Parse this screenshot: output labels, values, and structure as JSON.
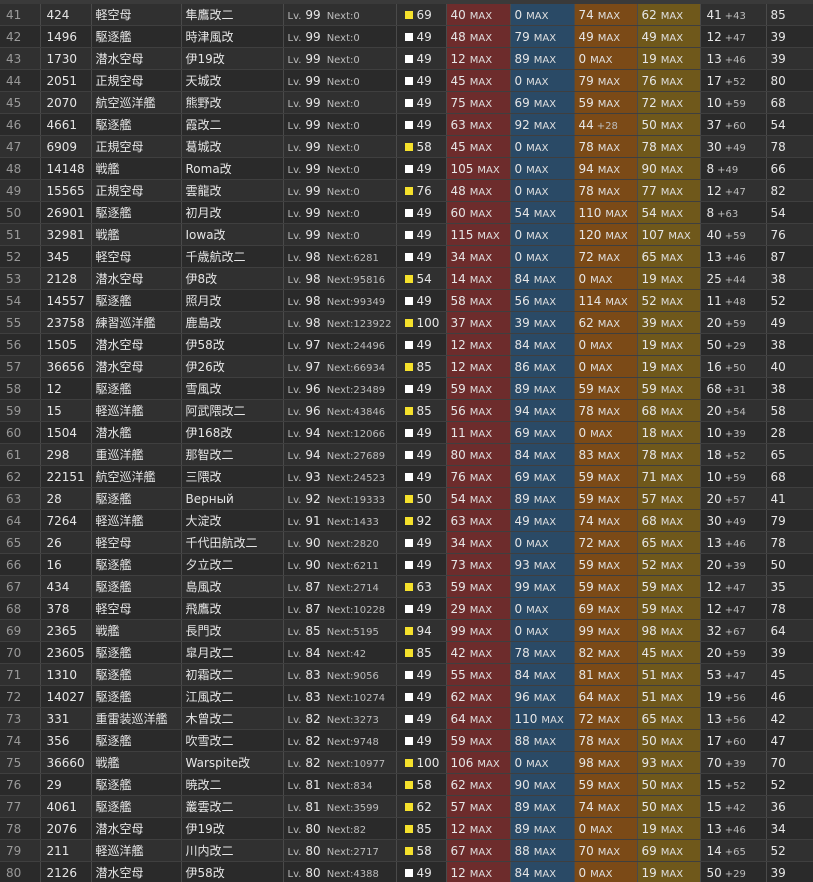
{
  "ship_list": {
    "rows": [
      {
        "idx": "41",
        "id": "424",
        "type": "軽空母",
        "name": "隼鷹改二",
        "lv": "99",
        "next": "Next:0",
        "cond_color": "yellow",
        "cond": "69",
        "fp": "40",
        "fp_max": "MAX",
        "tp": "0",
        "tp_max": "MAX",
        "aa": "74",
        "aa_max": "MAX",
        "ar": "62",
        "ar_max": "MAX",
        "luck": "41",
        "luck_inc": "+43",
        "last": "85"
      },
      {
        "idx": "42",
        "id": "1496",
        "type": "駆逐艦",
        "name": "時津風改",
        "lv": "99",
        "next": "Next:0",
        "cond_color": "white",
        "cond": "49",
        "fp": "48",
        "fp_max": "MAX",
        "tp": "79",
        "tp_max": "MAX",
        "aa": "49",
        "aa_max": "MAX",
        "ar": "49",
        "ar_max": "MAX",
        "luck": "12",
        "luck_inc": "+47",
        "last": "39"
      },
      {
        "idx": "43",
        "id": "1730",
        "type": "潜水空母",
        "name": "伊19改",
        "lv": "99",
        "next": "Next:0",
        "cond_color": "white",
        "cond": "49",
        "fp": "12",
        "fp_max": "MAX",
        "tp": "89",
        "tp_max": "MAX",
        "aa": "0",
        "aa_max": "MAX",
        "ar": "19",
        "ar_max": "MAX",
        "luck": "13",
        "luck_inc": "+46",
        "last": "39"
      },
      {
        "idx": "44",
        "id": "2051",
        "type": "正規空母",
        "name": "天城改",
        "lv": "99",
        "next": "Next:0",
        "cond_color": "white",
        "cond": "49",
        "fp": "45",
        "fp_max": "MAX",
        "tp": "0",
        "tp_max": "MAX",
        "aa": "79",
        "aa_max": "MAX",
        "ar": "76",
        "ar_max": "MAX",
        "luck": "17",
        "luck_inc": "+52",
        "last": "80"
      },
      {
        "idx": "45",
        "id": "2070",
        "type": "航空巡洋艦",
        "name": "熊野改",
        "lv": "99",
        "next": "Next:0",
        "cond_color": "white",
        "cond": "49",
        "fp": "75",
        "fp_max": "MAX",
        "tp": "69",
        "tp_max": "MAX",
        "aa": "59",
        "aa_max": "MAX",
        "ar": "72",
        "ar_max": "MAX",
        "luck": "10",
        "luck_inc": "+59",
        "last": "68"
      },
      {
        "idx": "46",
        "id": "4661",
        "type": "駆逐艦",
        "name": "霞改二",
        "lv": "99",
        "next": "Next:0",
        "cond_color": "white",
        "cond": "49",
        "fp": "63",
        "fp_max": "MAX",
        "tp": "92",
        "tp_max": "MAX",
        "aa": "44",
        "aa_max": "+28",
        "ar": "50",
        "ar_max": "MAX",
        "luck": "37",
        "luck_inc": "+60",
        "last": "54"
      },
      {
        "idx": "47",
        "id": "6909",
        "type": "正規空母",
        "name": "葛城改",
        "lv": "99",
        "next": "Next:0",
        "cond_color": "yellow",
        "cond": "58",
        "fp": "45",
        "fp_max": "MAX",
        "tp": "0",
        "tp_max": "MAX",
        "aa": "78",
        "aa_max": "MAX",
        "ar": "78",
        "ar_max": "MAX",
        "luck": "30",
        "luck_inc": "+49",
        "last": "78"
      },
      {
        "idx": "48",
        "id": "14148",
        "type": "戦艦",
        "name": "Roma改",
        "lv": "99",
        "next": "Next:0",
        "cond_color": "white",
        "cond": "49",
        "fp": "105",
        "fp_max": "MAX",
        "tp": "0",
        "tp_max": "MAX",
        "aa": "94",
        "aa_max": "MAX",
        "ar": "90",
        "ar_max": "MAX",
        "luck": "8",
        "luck_inc": "+49",
        "last": "66"
      },
      {
        "idx": "49",
        "id": "15565",
        "type": "正規空母",
        "name": "雲龍改",
        "lv": "99",
        "next": "Next:0",
        "cond_color": "yellow",
        "cond": "76",
        "fp": "48",
        "fp_max": "MAX",
        "tp": "0",
        "tp_max": "MAX",
        "aa": "78",
        "aa_max": "MAX",
        "ar": "77",
        "ar_max": "MAX",
        "luck": "12",
        "luck_inc": "+47",
        "last": "82"
      },
      {
        "idx": "50",
        "id": "26901",
        "type": "駆逐艦",
        "name": "初月改",
        "lv": "99",
        "next": "Next:0",
        "cond_color": "white",
        "cond": "49",
        "fp": "60",
        "fp_max": "MAX",
        "tp": "54",
        "tp_max": "MAX",
        "aa": "110",
        "aa_max": "MAX",
        "ar": "54",
        "ar_max": "MAX",
        "luck": "8",
        "luck_inc": "+63",
        "last": "54"
      },
      {
        "idx": "51",
        "id": "32981",
        "type": "戦艦",
        "name": "Iowa改",
        "lv": "99",
        "next": "Next:0",
        "cond_color": "white",
        "cond": "49",
        "fp": "115",
        "fp_max": "MAX",
        "tp": "0",
        "tp_max": "MAX",
        "aa": "120",
        "aa_max": "MAX",
        "ar": "107",
        "ar_max": "MAX",
        "luck": "40",
        "luck_inc": "+59",
        "last": "76"
      },
      {
        "idx": "52",
        "id": "345",
        "type": "軽空母",
        "name": "千歳航改二",
        "lv": "98",
        "next": "Next:6281",
        "cond_color": "white",
        "cond": "49",
        "fp": "34",
        "fp_max": "MAX",
        "tp": "0",
        "tp_max": "MAX",
        "aa": "72",
        "aa_max": "MAX",
        "ar": "65",
        "ar_max": "MAX",
        "luck": "13",
        "luck_inc": "+46",
        "last": "87"
      },
      {
        "idx": "53",
        "id": "2128",
        "type": "潜水空母",
        "name": "伊8改",
        "lv": "98",
        "next": "Next:95816",
        "cond_color": "yellow",
        "cond": "54",
        "fp": "14",
        "fp_max": "MAX",
        "tp": "84",
        "tp_max": "MAX",
        "aa": "0",
        "aa_max": "MAX",
        "ar": "19",
        "ar_max": "MAX",
        "luck": "25",
        "luck_inc": "+44",
        "last": "38"
      },
      {
        "idx": "54",
        "id": "14557",
        "type": "駆逐艦",
        "name": "照月改",
        "lv": "98",
        "next": "Next:99349",
        "cond_color": "white",
        "cond": "49",
        "fp": "58",
        "fp_max": "MAX",
        "tp": "56",
        "tp_max": "MAX",
        "aa": "114",
        "aa_max": "MAX",
        "ar": "52",
        "ar_max": "MAX",
        "luck": "11",
        "luck_inc": "+48",
        "last": "52"
      },
      {
        "idx": "55",
        "id": "23758",
        "type": "練習巡洋艦",
        "name": "鹿島改",
        "lv": "98",
        "next": "Next:123922",
        "cond_color": "yellow",
        "cond": "100",
        "fp": "37",
        "fp_max": "MAX",
        "tp": "39",
        "tp_max": "MAX",
        "aa": "62",
        "aa_max": "MAX",
        "ar": "39",
        "ar_max": "MAX",
        "luck": "20",
        "luck_inc": "+59",
        "last": "49"
      },
      {
        "idx": "56",
        "id": "1505",
        "type": "潜水空母",
        "name": "伊58改",
        "lv": "97",
        "next": "Next:24496",
        "cond_color": "white",
        "cond": "49",
        "fp": "12",
        "fp_max": "MAX",
        "tp": "84",
        "tp_max": "MAX",
        "aa": "0",
        "aa_max": "MAX",
        "ar": "19",
        "ar_max": "MAX",
        "luck": "50",
        "luck_inc": "+29",
        "last": "38"
      },
      {
        "idx": "57",
        "id": "36656",
        "type": "潜水空母",
        "name": "伊26改",
        "lv": "97",
        "next": "Next:66934",
        "cond_color": "yellow",
        "cond": "85",
        "fp": "12",
        "fp_max": "MAX",
        "tp": "86",
        "tp_max": "MAX",
        "aa": "0",
        "aa_max": "MAX",
        "ar": "19",
        "ar_max": "MAX",
        "luck": "16",
        "luck_inc": "+50",
        "last": "40"
      },
      {
        "idx": "58",
        "id": "12",
        "type": "駆逐艦",
        "name": "雪風改",
        "lv": "96",
        "next": "Next:23489",
        "cond_color": "white",
        "cond": "49",
        "fp": "59",
        "fp_max": "MAX",
        "tp": "89",
        "tp_max": "MAX",
        "aa": "59",
        "aa_max": "MAX",
        "ar": "59",
        "ar_max": "MAX",
        "luck": "68",
        "luck_inc": "+31",
        "last": "38"
      },
      {
        "idx": "59",
        "id": "15",
        "type": "軽巡洋艦",
        "name": "阿武隈改二",
        "lv": "96",
        "next": "Next:43846",
        "cond_color": "yellow",
        "cond": "85",
        "fp": "56",
        "fp_max": "MAX",
        "tp": "94",
        "tp_max": "MAX",
        "aa": "78",
        "aa_max": "MAX",
        "ar": "68",
        "ar_max": "MAX",
        "luck": "20",
        "luck_inc": "+54",
        "last": "58"
      },
      {
        "idx": "60",
        "id": "1504",
        "type": "潜水艦",
        "name": "伊168改",
        "lv": "94",
        "next": "Next:12066",
        "cond_color": "white",
        "cond": "49",
        "fp": "11",
        "fp_max": "MAX",
        "tp": "69",
        "tp_max": "MAX",
        "aa": "0",
        "aa_max": "MAX",
        "ar": "18",
        "ar_max": "MAX",
        "luck": "10",
        "luck_inc": "+39",
        "last": "28"
      },
      {
        "idx": "61",
        "id": "298",
        "type": "重巡洋艦",
        "name": "那智改二",
        "lv": "94",
        "next": "Next:27689",
        "cond_color": "white",
        "cond": "49",
        "fp": "80",
        "fp_max": "MAX",
        "tp": "84",
        "tp_max": "MAX",
        "aa": "83",
        "aa_max": "MAX",
        "ar": "78",
        "ar_max": "MAX",
        "luck": "18",
        "luck_inc": "+52",
        "last": "65"
      },
      {
        "idx": "62",
        "id": "22151",
        "type": "航空巡洋艦",
        "name": "三隈改",
        "lv": "93",
        "next": "Next:24523",
        "cond_color": "white",
        "cond": "49",
        "fp": "76",
        "fp_max": "MAX",
        "tp": "69",
        "tp_max": "MAX",
        "aa": "59",
        "aa_max": "MAX",
        "ar": "71",
        "ar_max": "MAX",
        "luck": "10",
        "luck_inc": "+59",
        "last": "68"
      },
      {
        "idx": "63",
        "id": "28",
        "type": "駆逐艦",
        "name": "Верный",
        "lv": "92",
        "next": "Next:19333",
        "cond_color": "yellow",
        "cond": "50",
        "fp": "54",
        "fp_max": "MAX",
        "tp": "89",
        "tp_max": "MAX",
        "aa": "59",
        "aa_max": "MAX",
        "ar": "57",
        "ar_max": "MAX",
        "luck": "20",
        "luck_inc": "+57",
        "last": "41"
      },
      {
        "idx": "64",
        "id": "7264",
        "type": "軽巡洋艦",
        "name": "大淀改",
        "lv": "91",
        "next": "Next:1433",
        "cond_color": "yellow",
        "cond": "92",
        "fp": "63",
        "fp_max": "MAX",
        "tp": "49",
        "tp_max": "MAX",
        "aa": "74",
        "aa_max": "MAX",
        "ar": "68",
        "ar_max": "MAX",
        "luck": "30",
        "luck_inc": "+49",
        "last": "79"
      },
      {
        "idx": "65",
        "id": "26",
        "type": "軽空母",
        "name": "千代田航改二",
        "lv": "90",
        "next": "Next:2820",
        "cond_color": "white",
        "cond": "49",
        "fp": "34",
        "fp_max": "MAX",
        "tp": "0",
        "tp_max": "MAX",
        "aa": "72",
        "aa_max": "MAX",
        "ar": "65",
        "ar_max": "MAX",
        "luck": "13",
        "luck_inc": "+46",
        "last": "78"
      },
      {
        "idx": "66",
        "id": "16",
        "type": "駆逐艦",
        "name": "夕立改二",
        "lv": "90",
        "next": "Next:6211",
        "cond_color": "white",
        "cond": "49",
        "fp": "73",
        "fp_max": "MAX",
        "tp": "93",
        "tp_max": "MAX",
        "aa": "59",
        "aa_max": "MAX",
        "ar": "52",
        "ar_max": "MAX",
        "luck": "20",
        "luck_inc": "+39",
        "last": "50"
      },
      {
        "idx": "67",
        "id": "434",
        "type": "駆逐艦",
        "name": "島風改",
        "lv": "87",
        "next": "Next:2714",
        "cond_color": "yellow",
        "cond": "63",
        "fp": "59",
        "fp_max": "MAX",
        "tp": "99",
        "tp_max": "MAX",
        "aa": "59",
        "aa_max": "MAX",
        "ar": "59",
        "ar_max": "MAX",
        "luck": "12",
        "luck_inc": "+47",
        "last": "35"
      },
      {
        "idx": "68",
        "id": "378",
        "type": "軽空母",
        "name": "飛鷹改",
        "lv": "87",
        "next": "Next:10228",
        "cond_color": "white",
        "cond": "49",
        "fp": "29",
        "fp_max": "MAX",
        "tp": "0",
        "tp_max": "MAX",
        "aa": "69",
        "aa_max": "MAX",
        "ar": "59",
        "ar_max": "MAX",
        "luck": "12",
        "luck_inc": "+47",
        "last": "78"
      },
      {
        "idx": "69",
        "id": "2365",
        "type": "戦艦",
        "name": "長門改",
        "lv": "85",
        "next": "Next:5195",
        "cond_color": "yellow",
        "cond": "94",
        "fp": "99",
        "fp_max": "MAX",
        "tp": "0",
        "tp_max": "MAX",
        "aa": "99",
        "aa_max": "MAX",
        "ar": "98",
        "ar_max": "MAX",
        "luck": "32",
        "luck_inc": "+67",
        "last": "64"
      },
      {
        "idx": "70",
        "id": "23605",
        "type": "駆逐艦",
        "name": "皐月改二",
        "lv": "84",
        "next": "Next:42",
        "cond_color": "yellow",
        "cond": "85",
        "fp": "42",
        "fp_max": "MAX",
        "tp": "78",
        "tp_max": "MAX",
        "aa": "82",
        "aa_max": "MAX",
        "ar": "45",
        "ar_max": "MAX",
        "luck": "20",
        "luck_inc": "+59",
        "last": "39"
      },
      {
        "idx": "71",
        "id": "1310",
        "type": "駆逐艦",
        "name": "初霜改二",
        "lv": "83",
        "next": "Next:9056",
        "cond_color": "white",
        "cond": "49",
        "fp": "55",
        "fp_max": "MAX",
        "tp": "84",
        "tp_max": "MAX",
        "aa": "81",
        "aa_max": "MAX",
        "ar": "51",
        "ar_max": "MAX",
        "luck": "53",
        "luck_inc": "+47",
        "last": "45"
      },
      {
        "idx": "72",
        "id": "14027",
        "type": "駆逐艦",
        "name": "江風改二",
        "lv": "83",
        "next": "Next:10274",
        "cond_color": "white",
        "cond": "49",
        "fp": "62",
        "fp_max": "MAX",
        "tp": "96",
        "tp_max": "MAX",
        "aa": "64",
        "aa_max": "MAX",
        "ar": "51",
        "ar_max": "MAX",
        "luck": "19",
        "luck_inc": "+56",
        "last": "46"
      },
      {
        "idx": "73",
        "id": "331",
        "type": "重雷装巡洋艦",
        "name": "木曾改二",
        "lv": "82",
        "next": "Next:3273",
        "cond_color": "white",
        "cond": "49",
        "fp": "64",
        "fp_max": "MAX",
        "tp": "110",
        "tp_max": "MAX",
        "aa": "72",
        "aa_max": "MAX",
        "ar": "65",
        "ar_max": "MAX",
        "luck": "13",
        "luck_inc": "+56",
        "last": "42"
      },
      {
        "idx": "74",
        "id": "356",
        "type": "駆逐艦",
        "name": "吹雪改二",
        "lv": "82",
        "next": "Next:9748",
        "cond_color": "white",
        "cond": "49",
        "fp": "59",
        "fp_max": "MAX",
        "tp": "88",
        "tp_max": "MAX",
        "aa": "78",
        "aa_max": "MAX",
        "ar": "50",
        "ar_max": "MAX",
        "luck": "17",
        "luck_inc": "+60",
        "last": "47"
      },
      {
        "idx": "75",
        "id": "36660",
        "type": "戦艦",
        "name": "Warspite改",
        "lv": "82",
        "next": "Next:10977",
        "cond_color": "yellow",
        "cond": "100",
        "fp": "106",
        "fp_max": "MAX",
        "tp": "0",
        "tp_max": "MAX",
        "aa": "98",
        "aa_max": "MAX",
        "ar": "93",
        "ar_max": "MAX",
        "luck": "70",
        "luck_inc": "+39",
        "last": "70"
      },
      {
        "idx": "76",
        "id": "29",
        "type": "駆逐艦",
        "name": "暁改二",
        "lv": "81",
        "next": "Next:834",
        "cond_color": "yellow",
        "cond": "58",
        "fp": "62",
        "fp_max": "MAX",
        "tp": "90",
        "tp_max": "MAX",
        "aa": "59",
        "aa_max": "MAX",
        "ar": "50",
        "ar_max": "MAX",
        "luck": "15",
        "luck_inc": "+52",
        "last": "52"
      },
      {
        "idx": "77",
        "id": "4061",
        "type": "駆逐艦",
        "name": "叢雲改二",
        "lv": "81",
        "next": "Next:3599",
        "cond_color": "yellow",
        "cond": "62",
        "fp": "57",
        "fp_max": "MAX",
        "tp": "89",
        "tp_max": "MAX",
        "aa": "74",
        "aa_max": "MAX",
        "ar": "50",
        "ar_max": "MAX",
        "luck": "15",
        "luck_inc": "+42",
        "last": "36"
      },
      {
        "idx": "78",
        "id": "2076",
        "type": "潜水空母",
        "name": "伊19改",
        "lv": "80",
        "next": "Next:82",
        "cond_color": "yellow",
        "cond": "85",
        "fp": "12",
        "fp_max": "MAX",
        "tp": "89",
        "tp_max": "MAX",
        "aa": "0",
        "aa_max": "MAX",
        "ar": "19",
        "ar_max": "MAX",
        "luck": "13",
        "luck_inc": "+46",
        "last": "34"
      },
      {
        "idx": "79",
        "id": "211",
        "type": "軽巡洋艦",
        "name": "川内改二",
        "lv": "80",
        "next": "Next:2717",
        "cond_color": "yellow",
        "cond": "58",
        "fp": "67",
        "fp_max": "MAX",
        "tp": "88",
        "tp_max": "MAX",
        "aa": "70",
        "aa_max": "MAX",
        "ar": "69",
        "ar_max": "MAX",
        "luck": "14",
        "luck_inc": "+65",
        "last": "52"
      },
      {
        "idx": "80",
        "id": "2126",
        "type": "潜水空母",
        "name": "伊58改",
        "lv": "80",
        "next": "Next:4388",
        "cond_color": "white",
        "cond": "49",
        "fp": "12",
        "fp_max": "MAX",
        "tp": "84",
        "tp_max": "MAX",
        "aa": "0",
        "aa_max": "MAX",
        "ar": "19",
        "ar_max": "MAX",
        "luck": "50",
        "luck_inc": "+29",
        "last": "39"
      }
    ],
    "lv_prefix": "Lv.",
    "colors": {
      "fp": "#6d2c2c",
      "tp": "#2a4a66",
      "aa": "#7b4a17",
      "ar": "#6f581b",
      "cond_yellow": "#f5e12c",
      "cond_white": "#ffffff"
    }
  }
}
